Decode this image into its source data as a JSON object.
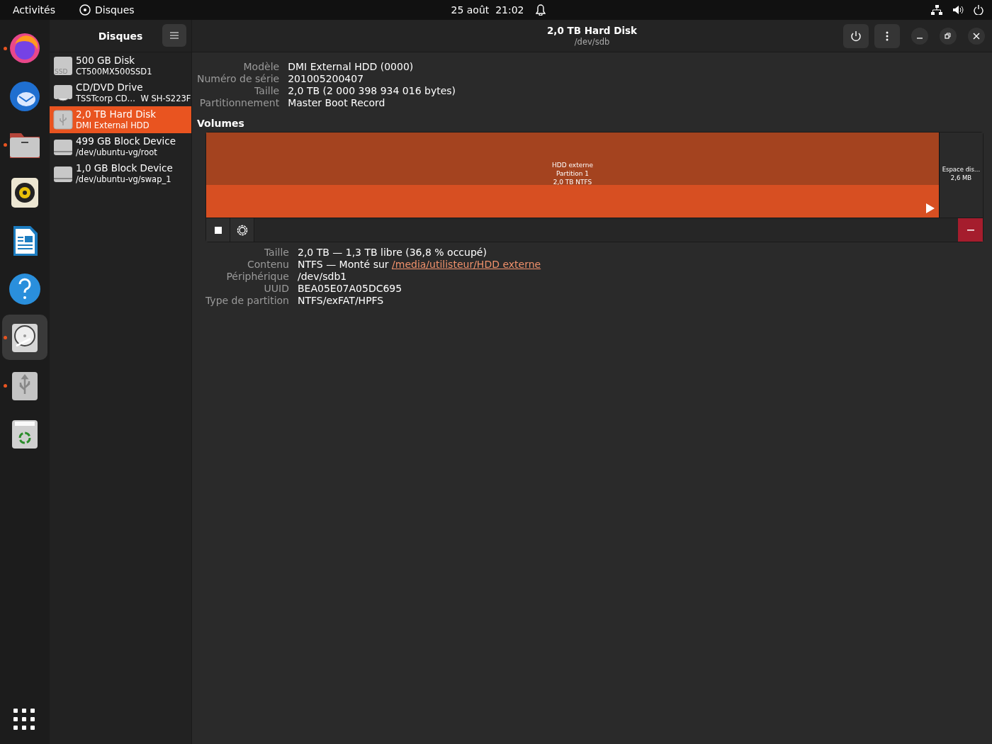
{
  "top_bar": {
    "activities": "Activités",
    "app_name": "Disques",
    "clock": "25 août  21:02"
  },
  "dock": [
    {
      "kind": "firefox",
      "running": true
    },
    {
      "kind": "mail",
      "running": false
    },
    {
      "kind": "files",
      "running": true
    },
    {
      "kind": "music",
      "running": false
    },
    {
      "kind": "writer",
      "running": false
    },
    {
      "kind": "help",
      "running": false
    },
    {
      "kind": "disks",
      "running": true,
      "selected": true
    },
    {
      "kind": "usb",
      "running": true
    },
    {
      "kind": "trash",
      "running": false
    }
  ],
  "sidebar": {
    "title": "Disques",
    "devices": [
      {
        "kind": "ssd",
        "name": "500 GB Disk",
        "detail": "CT500MX500SSD1",
        "badge": "SSD",
        "selected": false
      },
      {
        "kind": "optical",
        "name": "CD/DVD Drive",
        "detail": "TSSTcorp CD…  W SH-S223F",
        "selected": false
      },
      {
        "kind": "usb",
        "name": "2,0 TB Hard Disk",
        "detail": "DMI External HDD",
        "selected": true
      },
      {
        "kind": "block",
        "name": "499 GB Block Device",
        "detail": "/dev/ubuntu-vg/root",
        "selected": false
      },
      {
        "kind": "block",
        "name": "1,0 GB Block Device",
        "detail": "/dev/ubuntu-vg/swap_1",
        "selected": false
      }
    ]
  },
  "header": {
    "title": "2,0 TB Hard Disk",
    "subtitle": "/dev/sdb"
  },
  "disk_info": [
    {
      "label": "Modèle",
      "value": "DMI External HDD (0000)"
    },
    {
      "label": "Numéro de série",
      "value": "201005200407"
    },
    {
      "label": "Taille",
      "value": "2,0 TB (2 000 398 934 016 bytes)"
    },
    {
      "label": "Partitionnement",
      "value": "Master Boot Record"
    }
  ],
  "volumes_heading": "Volumes",
  "volumes": [
    {
      "kind": "partition",
      "selected": true,
      "lines": [
        "HDD externe",
        "Partition 1",
        "2,0 TB NTFS"
      ]
    },
    {
      "kind": "free",
      "selected": false,
      "lines": [
        "Espace dis…",
        "2,6 MB"
      ]
    }
  ],
  "volume_info": [
    {
      "label": "Taille",
      "value": "2,0 TB — 1,3 TB libre (36,8 % occupé)"
    },
    {
      "label": "Contenu",
      "value": "NTFS — Monté sur ",
      "link": "/media/utilisteur/HDD externe"
    },
    {
      "label": "Périphérique",
      "value": "/dev/sdb1"
    },
    {
      "label": "UUID",
      "value": "BEA05E07A05DC695"
    },
    {
      "label": "Type de partition",
      "value": "NTFS/exFAT/HPFS"
    }
  ]
}
